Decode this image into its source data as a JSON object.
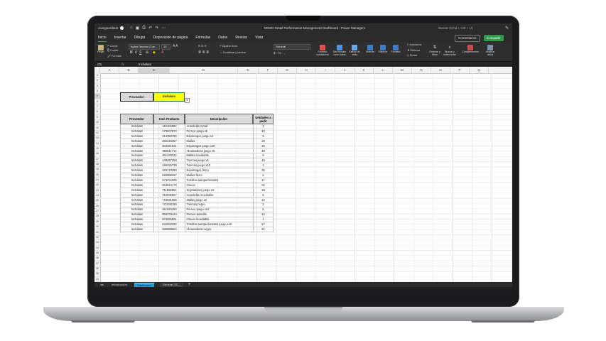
{
  "titlebar": {
    "autosave_label": "Autoguardado",
    "document_title": "DEMO Retail Performance Management Dashboard - Power Managers",
    "search_placeholder": "Buscar (Cmd + Ctrl + U)"
  },
  "ribbon_tabs": [
    "Inicio",
    "Insertar",
    "Dibujar",
    "Disposición de página",
    "Fórmulas",
    "Datos",
    "Revisar",
    "Vista"
  ],
  "ribbon_buttons": {
    "comments": "Comentarios",
    "share": "Compartir",
    "paste": "Pegar",
    "cut": "Cortar",
    "copy": "Copiar",
    "format": "Formato",
    "font_name": "Aptos Narrow (Cue...",
    "font_size": "12",
    "wrap_text": "Ajustar texto",
    "merge_center": "Combinar y centrar",
    "number_format": "General",
    "conditional_format": "Formato condicional",
    "format_as_table": "Dar formato como tabla",
    "cell_styles": "Estilos de celda",
    "insert": "Insertar",
    "delete": "Eliminar",
    "format_cells": "Formato",
    "autosum": "Autosuma",
    "fill": "Rellenar",
    "clear": "Borrar",
    "sort_filter": "Ordenar y filtrar",
    "find_select": "Buscar y seleccionar",
    "addins": "Complementos",
    "analyze_data": "Analizar datos"
  },
  "formula_bar": {
    "cell_ref": "C5",
    "fx": "fx",
    "value": "Inchalam"
  },
  "columns": [
    "A",
    "B",
    "C",
    "D",
    "E",
    "F",
    "G",
    "H",
    "I",
    "J",
    "K",
    "L",
    "M",
    "N",
    "O",
    "P",
    "Q"
  ],
  "rows": [
    "1",
    "2",
    "3",
    "4",
    "5",
    "6",
    "7",
    "8",
    "9",
    "10",
    "11",
    "12",
    "13",
    "14",
    "15",
    "16",
    "17",
    "18",
    "19",
    "20",
    "21",
    "22",
    "23",
    "24",
    "25",
    "26",
    "27",
    "28",
    "29",
    "30",
    "31",
    "32",
    "33",
    "34",
    "35",
    "36",
    "37",
    "38",
    "39",
    "40"
  ],
  "provider": {
    "label": "Proveedor:",
    "value": "Inchalam"
  },
  "table": {
    "headers": [
      "Proveedor",
      "Cod. Producto",
      "Descripción",
      "Unidades a pedir"
    ],
    "rows": [
      [
        "Inchalam",
        "112184982",
        "Arandelas metal",
        "3"
      ],
      [
        "Inchalam",
        "173537573",
        "Pernos juego x5",
        "40"
      ],
      [
        "Inchalam",
        "214365785",
        "Espárragos juego x3",
        "5"
      ],
      [
        "Inchalam",
        "256226357",
        "Mallas",
        "29"
      ],
      [
        "Inchalam",
        "343361931",
        "Espárragos juego x10",
        "45"
      ],
      [
        "Inchalam",
        "359511714",
        "Abrazaderas juego x5",
        "33"
      ],
      [
        "Inchalam",
        "361230342",
        "Mallas inoxidable",
        "8"
      ],
      [
        "Inchalam",
        "448287368",
        "Tuercas juego x5",
        "49"
      ],
      [
        "Inchalam",
        "466026739",
        "Tuercas juego x10",
        "1"
      ],
      [
        "Inchalam",
        "484170280",
        "Espárragos fierro",
        "25"
      ],
      [
        "Inchalam",
        "526989497",
        "Mallas fierro",
        "4"
      ],
      [
        "Inchalam",
        "573212205",
        "Tornillos autoperforantes",
        "17"
      ],
      [
        "Inchalam",
        "664844179",
        "Clavos",
        "22"
      ],
      [
        "Inchalam",
        "711868964",
        "Sujetadores juego x3",
        "19"
      ],
      [
        "Inchalam",
        "713035567",
        "Arandelas inoxidable",
        "5"
      ],
      [
        "Inchalam",
        "718691586",
        "Mallas juego x3",
        "24"
      ],
      [
        "Inchalam",
        "771536189",
        "Tuercas negro",
        "3"
      ],
      [
        "Inchalam",
        "811646400",
        "Pernos juego x10",
        "6"
      ],
      [
        "Inchalam",
        "850276424",
        "Pernos amarillo",
        "44"
      ],
      [
        "Inchalam",
        "874825001",
        "Clavos inoxidable",
        "1"
      ],
      [
        "Inchalam",
        "942002322",
        "Tornillos autoperforantes juego x10",
        "67"
      ],
      [
        "Inchalam",
        "986966564",
        "Abrazaderas negro",
        "12"
      ]
    ]
  },
  "sheet_tabs": [
    "Introducción",
    "Dashboard",
    "Generar OC..."
  ],
  "active_sheet": "Dashboard",
  "colors": {
    "provider_highlight": "#ffff00",
    "header_fill": "#d9d9d9",
    "share_button": "#2e9b4c",
    "active_sheet_tab": "#1fa3d4"
  }
}
